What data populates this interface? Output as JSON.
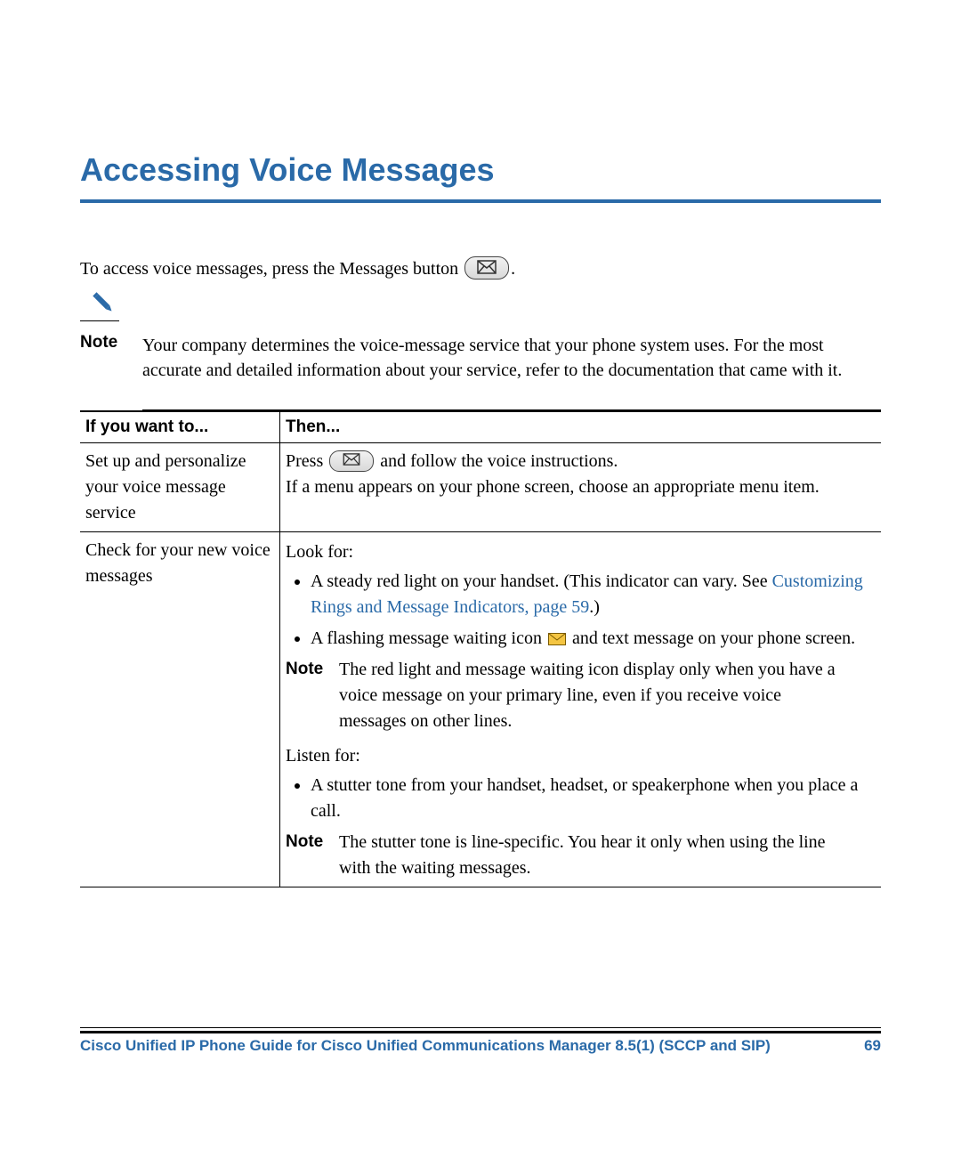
{
  "title": "Accessing Voice Messages",
  "intro": {
    "before_icon": "To access voice messages, press the Messages button ",
    "after_icon": "."
  },
  "note": {
    "label": "Note",
    "text": "Your company determines the voice-message service that your phone system uses. For the most accurate and detailed information about your service, refer to the documentation that came with it."
  },
  "table": {
    "headers": {
      "col1": "If you want to...",
      "col2": "Then..."
    },
    "rows": [
      {
        "want": "Set up and personalize your voice message service",
        "then": {
          "press_before": "Press ",
          "press_after": " and follow the voice instructions.",
          "line2": "If a menu appears on your phone screen, choose an appropriate menu item."
        }
      },
      {
        "want": "Check for your new voice messages",
        "then": {
          "lookfor_label": "Look for:",
          "bullet1_a": "A steady red light on your handset. (This indicator can vary. See ",
          "bullet1_link": "Customizing Rings and Message Indicators, page 59",
          "bullet1_b": ".)",
          "bullet2_a": "A flashing message waiting icon ",
          "bullet2_b": " and text message on your phone screen.",
          "note1_label": "Note",
          "note1_text": "The red light and message waiting icon display only when you have a voice message on your primary line, even if you receive voice messages on other lines.",
          "listenfor_label": "Listen for:",
          "bullet3": "A stutter tone from your handset, headset, or speakerphone when you place a call.",
          "note2_label": "Note",
          "note2_text": "The stutter tone is line-specific. You hear it only when using the line with the waiting messages."
        }
      }
    ]
  },
  "footer": {
    "text": "Cisco Unified IP Phone Guide for Cisco Unified Communications Manager 8.5(1) (SCCP and SIP)",
    "page": "69"
  },
  "icons": {
    "messages_button": "messages-button-icon",
    "envelope_yellow": "envelope-yellow-icon",
    "pencil": "pencil-icon"
  }
}
